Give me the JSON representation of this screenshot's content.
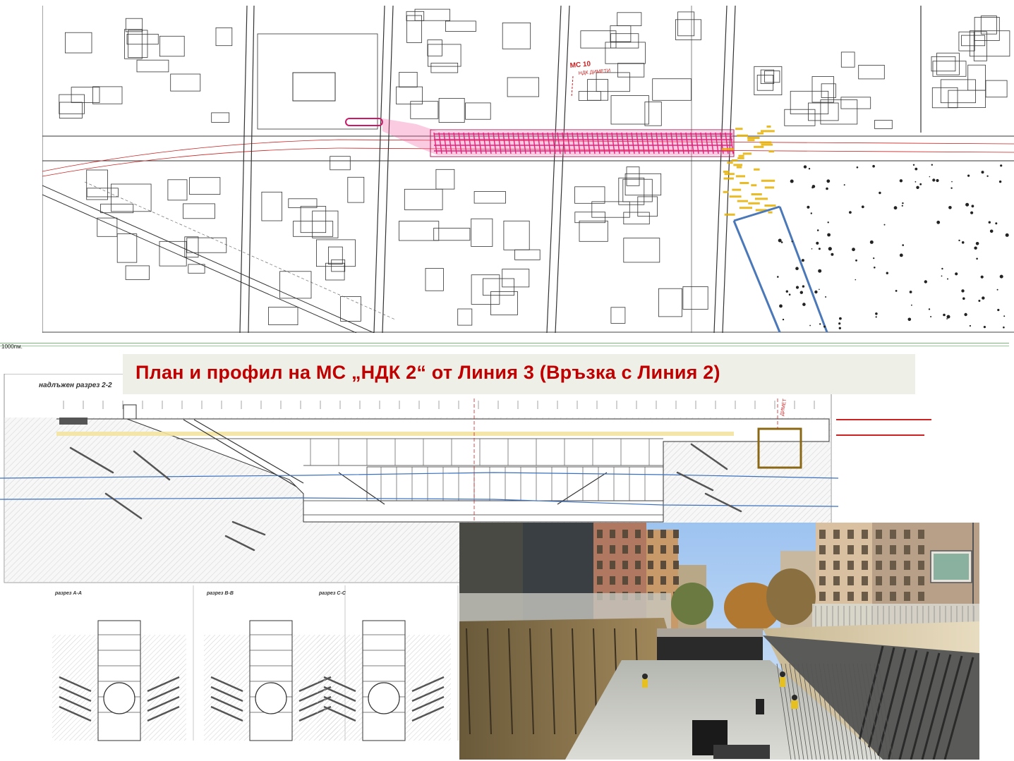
{
  "title": "План и профил на МС „НДК 2“ от Линия 3 (Връзка с Линия 2)",
  "plan": {
    "station_label": "МС 10",
    "station_sublabel": "НДК ДИМЕТИ"
  },
  "profile": {
    "scale_label": "1000пм.",
    "section_label": "надлъжен разрез 2-2",
    "marker_label": "ДИМЕТ"
  },
  "cross_sections": {
    "labels": [
      "разрез А-А",
      "разрез В-В",
      "разрез С-С"
    ]
  },
  "colors": {
    "title": "#c00000",
    "pink_station": "#e8207a",
    "yellow_link": "#e6b000",
    "blue_lines": "#4a78b8",
    "red_marks": "#cc2222"
  }
}
